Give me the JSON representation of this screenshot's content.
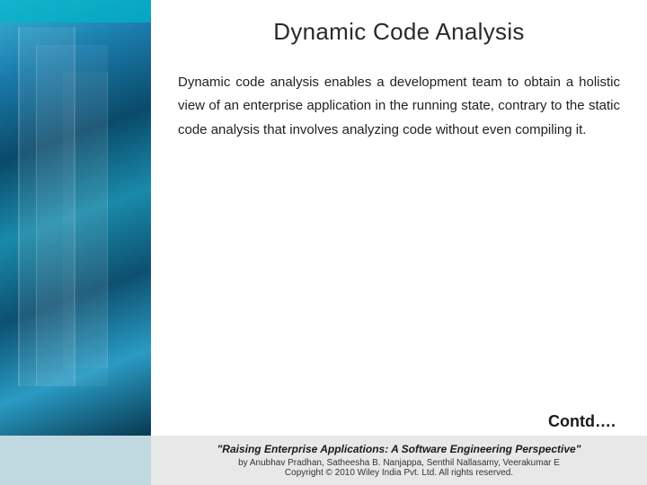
{
  "slide": {
    "title": "Dynamic Code Analysis",
    "body_text": "Dynamic code analysis enables a development team to obtain a holistic view of an enterprise application in the running state, contrary to the static code analysis that involves analyzing code without even compiling it.",
    "contd_label": "Contd….",
    "footer": {
      "book_title": "\"Raising Enterprise Applications: A Software Engineering Perspective\"",
      "authors_line": "by Anubhav Pradhan, Satheesha B. Nanjappa, Senthil Nallasamy, Veerakumar E",
      "copyright_line": "Copyright © 2010 Wiley India Pvt. Ltd.  All rights reserved."
    }
  }
}
